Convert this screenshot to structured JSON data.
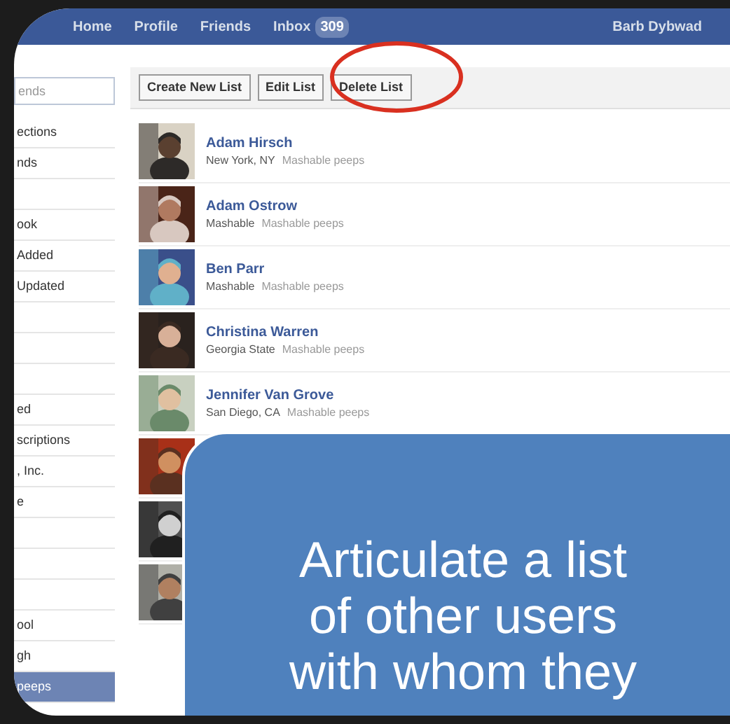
{
  "nav": {
    "items": [
      {
        "label": "Home"
      },
      {
        "label": "Profile"
      },
      {
        "label": "Friends"
      },
      {
        "label": "Inbox",
        "badge": "309"
      }
    ],
    "user": "Barb Dybwad"
  },
  "sidebar": {
    "search": {
      "placeholder": "ends"
    },
    "items": [
      {
        "kind": "label",
        "label": "ections",
        "selected": false
      },
      {
        "kind": "label",
        "label": "nds",
        "selected": false
      },
      {
        "kind": "blank",
        "selected": false
      },
      {
        "kind": "label",
        "label": "ook",
        "selected": false
      },
      {
        "kind": "label",
        "label": "Added",
        "selected": false
      },
      {
        "kind": "label",
        "label": "Updated",
        "selected": false
      },
      {
        "kind": "blank",
        "selected": false
      },
      {
        "kind": "blank",
        "selected": false
      },
      {
        "kind": "blank",
        "selected": false
      },
      {
        "kind": "label",
        "label": "ed",
        "selected": false
      },
      {
        "kind": "label",
        "label": "scriptions",
        "selected": false
      },
      {
        "kind": "label",
        "label": ", Inc.",
        "selected": false
      },
      {
        "kind": "label",
        "label": "e",
        "selected": false
      },
      {
        "kind": "blank",
        "selected": false
      },
      {
        "kind": "blank",
        "selected": false
      },
      {
        "kind": "blank",
        "selected": false
      },
      {
        "kind": "label",
        "label": "ool",
        "selected": false
      },
      {
        "kind": "label",
        "label": "gh",
        "selected": false
      },
      {
        "kind": "label",
        "label": "peeps",
        "selected": true
      }
    ]
  },
  "toolbar": {
    "buttons": [
      "Create New List",
      "Edit List",
      "Delete List"
    ]
  },
  "friends": [
    {
      "name": "Adam Hirsch",
      "network": "New York, NY",
      "list": "Mashable peeps",
      "avatar": {
        "kind": "picture"
      }
    },
    {
      "name": "Adam Ostrow",
      "network": "Mashable",
      "list": "Mashable peeps",
      "avatar": {
        "kind": "picture"
      }
    },
    {
      "name": "Ben Parr",
      "network": "Mashable",
      "list": "Mashable peeps",
      "avatar": {
        "kind": "picture"
      }
    },
    {
      "name": "Christina Warren",
      "network": "Georgia State",
      "list": "Mashable peeps",
      "avatar": {
        "kind": "picture"
      }
    },
    {
      "name": "Jennifer Van Grove",
      "network": "San Diego, CA",
      "list": "Mashable peeps",
      "avatar": {
        "kind": "picture"
      }
    },
    {
      "avatar": {
        "kind": "picture"
      }
    },
    {
      "avatar": {
        "kind": "picture"
      }
    },
    {
      "avatar": {
        "kind": "picture"
      }
    }
  ],
  "callout": {
    "lines": [
      "Articulate a list",
      "of other users",
      "with whom they"
    ]
  }
}
